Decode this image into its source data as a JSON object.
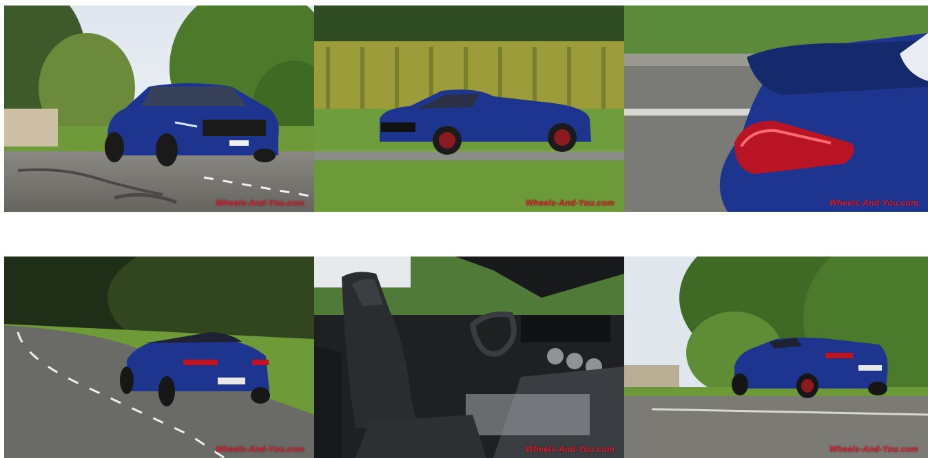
{
  "gallery": {
    "watermark": "Wheels-And-You.com",
    "images": [
      {
        "name": "front-three-quarter"
      },
      {
        "name": "side-profile-motion"
      },
      {
        "name": "taillight-detail"
      },
      {
        "name": "rear-on-road"
      },
      {
        "name": "interior-seats"
      },
      {
        "name": "rear-three-quarter-field"
      }
    ]
  },
  "colors": {
    "car_blue": "#1e3590",
    "grass": "#5d8a34",
    "asphalt": "#6f6e69",
    "watermark_red": "#e01a2b"
  }
}
